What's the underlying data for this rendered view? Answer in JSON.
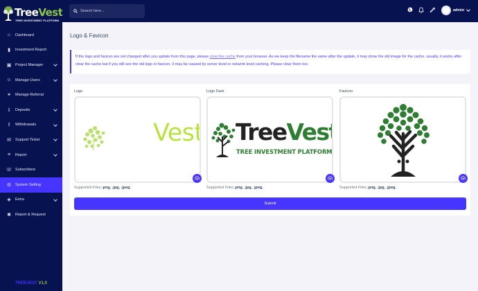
{
  "brand": {
    "name_part1": "Tree",
    "name_part2": "Vest",
    "tagline": "TREE INVESTMENT PLATFORM",
    "version_part1": "TREEVEST",
    "version_part2": "V1.0"
  },
  "colors": {
    "sidebar_bg": "#071251",
    "accent": "#4634ff",
    "brand_green": "#8bc34a",
    "page_bg": "#f3f3f9"
  },
  "search": {
    "placeholder": "Search here..."
  },
  "topbar": {
    "admin_name": "admin",
    "icons": [
      "globe-icon",
      "bell-icon",
      "wrench-icon",
      "avatar"
    ]
  },
  "sidebar": {
    "items": [
      {
        "label": "Dashboard",
        "icon": "home-icon",
        "has_submenu": false,
        "active": false
      },
      {
        "label": "Investment Report",
        "icon": "bar-chart-icon",
        "has_submenu": false,
        "active": false
      },
      {
        "label": "Project Manager",
        "icon": "briefcase-icon",
        "has_submenu": true,
        "active": false
      },
      {
        "label": "Manage Users",
        "icon": "users-icon",
        "has_submenu": true,
        "active": false
      },
      {
        "label": "Manage Referral",
        "icon": "link-icon",
        "has_submenu": false,
        "active": false
      },
      {
        "label": "Deposits",
        "icon": "deposit-icon",
        "has_submenu": true,
        "active": false
      },
      {
        "label": "Withdrawals",
        "icon": "withdraw-icon",
        "has_submenu": true,
        "active": false
      },
      {
        "label": "Support Ticket",
        "icon": "ticket-icon",
        "has_submenu": true,
        "active": false
      },
      {
        "label": "Report",
        "icon": "report-icon",
        "has_submenu": true,
        "active": false
      },
      {
        "label": "Subscribers",
        "icon": "subscribers-icon",
        "has_submenu": false,
        "active": false
      },
      {
        "label": "System Setting",
        "icon": "gear-icon",
        "has_submenu": false,
        "active": true
      },
      {
        "label": "Extra",
        "icon": "layers-icon",
        "has_submenu": true,
        "active": false
      },
      {
        "label": "Report & Request",
        "icon": "bug-icon",
        "has_submenu": false,
        "active": false
      }
    ]
  },
  "main": {
    "page_title": "Logo & Favicon",
    "alert": {
      "text_before": "If the logo and favicon are not changed after you update from this page, please ",
      "link": "clear the cache",
      "text_after": " from your browser. As we keep the filename the same after the update, it may show the old image for the cache. usually, it works after clear the cache but if you still see the old logo or favicon, it may be caused by server level or network level caching. Please clear them too."
    },
    "uploads": [
      {
        "label": "Logo",
        "supported_prefix": "Supported Files:",
        "supported_types": ".png, .jpg, .jpeg.",
        "preview_text": "Vest"
      },
      {
        "label": "Logo Dark",
        "supported_prefix": "Supported Files:",
        "supported_types": ".png, .jpg, .jpeg.",
        "preview_text_1": "Tree",
        "preview_text_2": "Vest",
        "preview_tagline": "TREE INVESTMENT PLATFORM"
      },
      {
        "label": "Favicon",
        "supported_prefix": "Supported Files:",
        "supported_types": ".png, .jpg, .jpeg."
      }
    ],
    "submit_label": "Submit"
  }
}
